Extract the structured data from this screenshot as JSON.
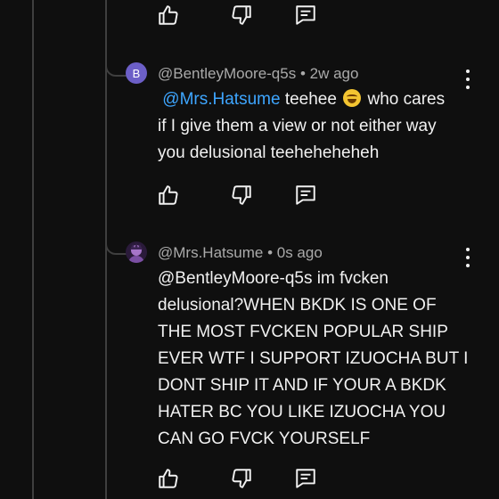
{
  "comments": [
    {
      "avatar_letter": "B",
      "avatar_color": "#6c5fc7",
      "handle": "@BentleyMoore-q5s",
      "time": "2w ago",
      "mention": "@Mrs.Hatsume",
      "lines": [
        "teehee",
        "who cares",
        "if I give them a view or not either way",
        "you delusional teeheheheheh"
      ]
    },
    {
      "avatar_colors": [
        "#2a1a3a",
        "#a675c9"
      ],
      "handle": "@Mrs.Hatsume",
      "time": "0s ago",
      "lines": [
        "@BentleyMoore-q5s im fvcken",
        "delusional?WHEN BKDK IS ONE OF",
        "THE MOST FVCKEN POPULAR SHIP",
        "EVER WTF I SUPPORT IZUOCHA BUT I",
        "DONT SHIP IT AND IF YOUR A BKDK",
        "HATER BC YOU LIKE IZUOCHA YOU",
        "CAN GO FVCK YOURSELF"
      ]
    }
  ],
  "separator": "•",
  "icons": {
    "like": "thumbs-up-icon",
    "dislike": "thumbs-down-icon",
    "reply": "reply-comment-icon",
    "more": "more-vert-icon",
    "emoji": "laughing-tears-emoji"
  },
  "colors": {
    "background": "#0f0f0f",
    "text": "#f1f1f1",
    "meta": "#aaaaaa",
    "mention": "#3ea6ff",
    "thread": "#3f3f3f"
  }
}
